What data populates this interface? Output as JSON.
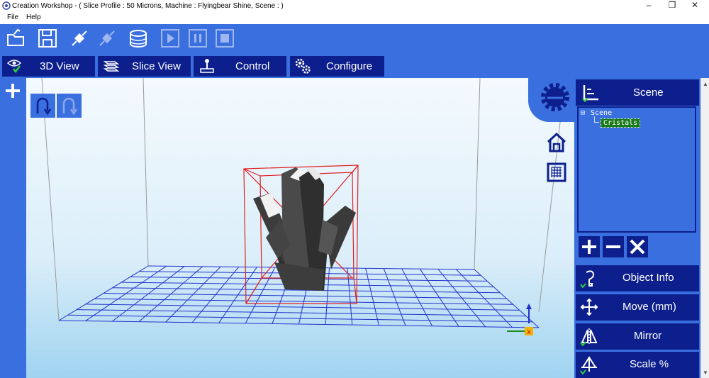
{
  "window": {
    "app_name": "Creation Workshop",
    "title": "Creation Workshop -   ( Slice Profile : 50 Microns, Machine : Flyingbear Shine, Scene : )",
    "controls": {
      "minimize": "–",
      "maximize": "❐",
      "close": "✕"
    }
  },
  "menu": {
    "items": [
      "File",
      "Help"
    ]
  },
  "toolbar": {
    "buttons": [
      "open-folder-icon",
      "save-icon",
      "connect-icon",
      "disconnect-icon",
      "slice-icon",
      "play-icon",
      "pause-icon",
      "stop-icon"
    ]
  },
  "tabs": [
    {
      "label": "3D View",
      "icon": "eye-check-icon"
    },
    {
      "label": "Slice View",
      "icon": "layers-icon"
    },
    {
      "label": "Control",
      "icon": "joystick-icon"
    },
    {
      "label": "Configure",
      "icon": "gears-icon"
    }
  ],
  "viewport": {
    "undo_icon": "undo-icon",
    "redo_icon": "redo-icon",
    "add_icon": "plus-icon",
    "view_icons": [
      "view-settings-gear-icon",
      "home-view-icon",
      "top-view-grid-icon"
    ]
  },
  "scene_panel": {
    "title": "Scene",
    "tree": {
      "root": "Scene",
      "child": "Cristals"
    },
    "actions": [
      "add-object-icon",
      "remove-object-icon",
      "delete-object-icon"
    ]
  },
  "side_buttons": [
    {
      "label": "Object Info",
      "icon": "object-info-icon"
    },
    {
      "label": "Move (mm)",
      "icon": "move-arrows-icon"
    },
    {
      "label": "Mirror",
      "icon": "mirror-icon"
    },
    {
      "label": "Scale %",
      "icon": "scale-icon"
    }
  ],
  "colors": {
    "toolbar_blue": "#3a6fe0",
    "dark_navy": "#0d1f8c",
    "selection_green": "#1a7a1a",
    "grid_blue": "#2233cc",
    "bbox_red": "#e02020"
  }
}
